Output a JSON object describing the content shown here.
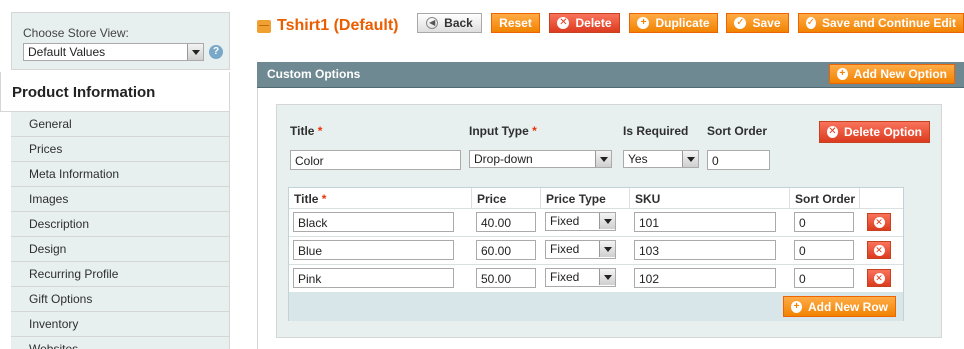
{
  "store_switcher": {
    "label": "Choose Store View:",
    "selected": "Default Values",
    "help_icon": "?"
  },
  "sidebar": {
    "title": "Product Information",
    "items": [
      {
        "label": "General"
      },
      {
        "label": "Prices"
      },
      {
        "label": "Meta Information"
      },
      {
        "label": "Images"
      },
      {
        "label": "Description"
      },
      {
        "label": "Design"
      },
      {
        "label": "Recurring Profile"
      },
      {
        "label": "Gift Options"
      },
      {
        "label": "Inventory"
      },
      {
        "label": "Websites"
      }
    ]
  },
  "header": {
    "title": "Tshirt1 (Default)",
    "buttons": {
      "back": "Back",
      "reset": "Reset",
      "delete": "Delete",
      "duplicate": "Duplicate",
      "save": "Save",
      "save_continue": "Save and Continue Edit"
    }
  },
  "custom_options": {
    "heading": "Custom Options",
    "add_new_option": "Add New Option",
    "option": {
      "title_label": "Title",
      "input_type_label": "Input Type",
      "is_required_label": "Is Required",
      "sort_order_label": "Sort Order",
      "required_mark": "*",
      "delete_option": "Delete Option",
      "title_value": "Color",
      "input_type_value": "Drop-down",
      "is_required_value": "Yes",
      "sort_order_value": "0"
    },
    "rows_table": {
      "headers": {
        "title": "Title",
        "price": "Price",
        "price_type": "Price Type",
        "sku": "SKU",
        "sort_order": "Sort Order"
      },
      "rows": [
        {
          "title": "Black",
          "price": "40.00",
          "price_type": "Fixed",
          "sku": "101",
          "sort_order": "0"
        },
        {
          "title": "Blue",
          "price": "60.00",
          "price_type": "Fixed",
          "sku": "103",
          "sort_order": "0"
        },
        {
          "title": "Pink",
          "price": "50.00",
          "price_type": "Fixed",
          "sku": "102",
          "sort_order": "0"
        }
      ],
      "add_new_row": "Add New Row"
    }
  },
  "colors": {
    "accent_orange": "#f18200",
    "title_orange": "#eb5e00",
    "danger_red": "#dc3b1f",
    "panel_header": "#6f8992",
    "panel_bg": "#e7efef"
  }
}
